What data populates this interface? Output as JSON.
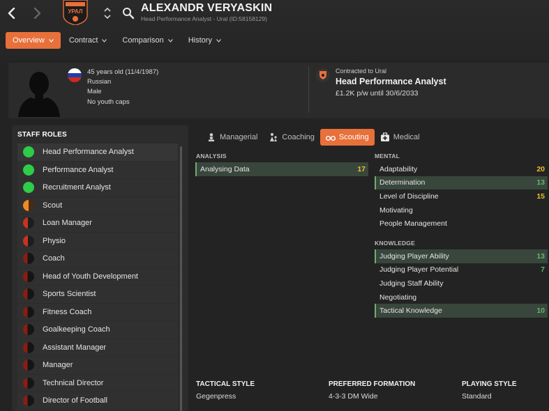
{
  "header": {
    "name": "ALEXANDR VERYASKIN",
    "subtitle": "Head Performance Analyst - Ural (ID:58158129)",
    "club_badge_text": "УРАЛ",
    "tabs": [
      {
        "label": "Overview",
        "active": true
      },
      {
        "label": "Contract",
        "active": false
      },
      {
        "label": "Comparison",
        "active": false
      },
      {
        "label": "History",
        "active": false
      }
    ]
  },
  "profile": {
    "age": "45 years old (11/4/1987)",
    "nationality": "Russian",
    "gender": "Male",
    "youth_caps": "No youth caps",
    "contract_label": "Contracted to Ural",
    "contract_role": "Head Performance Analyst",
    "wage": "£1.2K p/w until 30/6/2033"
  },
  "roles": {
    "title": "STAFF ROLES",
    "items": [
      {
        "label": "Head Performance Analyst",
        "rating": "green",
        "selected": true
      },
      {
        "label": "Performance Analyst",
        "rating": "green"
      },
      {
        "label": "Recruitment Analyst",
        "rating": "green"
      },
      {
        "label": "Scout",
        "rating": "orange"
      },
      {
        "label": "Loan Manager",
        "rating": "red"
      },
      {
        "label": "Physio",
        "rating": "red"
      },
      {
        "label": "Coach",
        "rating": "darkred"
      },
      {
        "label": "Head of Youth Development",
        "rating": "darkred"
      },
      {
        "label": "Sports Scientist",
        "rating": "darkred"
      },
      {
        "label": "Fitness Coach",
        "rating": "darkred"
      },
      {
        "label": "Goalkeeping Coach",
        "rating": "darkred"
      },
      {
        "label": "Assistant Manager",
        "rating": "darkred"
      },
      {
        "label": "Manager",
        "rating": "darkred"
      },
      {
        "label": "Technical Director",
        "rating": "darkred"
      },
      {
        "label": "Director of Football",
        "rating": "darkred"
      }
    ]
  },
  "subtabs": [
    {
      "label": "Managerial",
      "icon": "chess-pawn-icon",
      "active": false
    },
    {
      "label": "Coaching",
      "icon": "coaching-icon",
      "active": false
    },
    {
      "label": "Scouting",
      "icon": "binoculars-icon",
      "active": true
    },
    {
      "label": "Medical",
      "icon": "medical-kit-icon",
      "active": false
    }
  ],
  "analysis": {
    "title": "ANALYSIS",
    "items": [
      {
        "label": "Analysing Data",
        "value": "17",
        "color": "yellow",
        "hl": true
      }
    ]
  },
  "mental": {
    "title": "MENTAL",
    "items": [
      {
        "label": "Adaptability",
        "value": "20",
        "color": "yellow",
        "hl": false
      },
      {
        "label": "Determination",
        "value": "13",
        "color": "green",
        "hl": true
      },
      {
        "label": "Level of Discipline",
        "value": "15",
        "color": "yellow",
        "hl": false
      },
      {
        "label": "Motivating",
        "value": "",
        "color": "",
        "hl": false
      },
      {
        "label": "People Management",
        "value": "",
        "color": "",
        "hl": false
      }
    ]
  },
  "knowledge": {
    "title": "KNOWLEDGE",
    "items": [
      {
        "label": "Judging Player Ability",
        "value": "13",
        "color": "green",
        "hl": true
      },
      {
        "label": "Judging Player Potential",
        "value": "7",
        "color": "green",
        "hl": false
      },
      {
        "label": "Judging Staff Ability",
        "value": "",
        "color": "",
        "hl": false
      },
      {
        "label": "Negotiating",
        "value": "",
        "color": "",
        "hl": false
      },
      {
        "label": "Tactical Knowledge",
        "value": "10",
        "color": "green",
        "hl": true
      }
    ]
  },
  "tactics": {
    "style_label": "TACTICAL STYLE",
    "style_value": "Gegenpress",
    "formation_label": "PREFERRED FORMATION",
    "formation_value": "4-3-3 DM Wide",
    "playing_label": "PLAYING STYLE",
    "playing_value": "Standard"
  },
  "colors": {
    "accent": "#e8703a",
    "green": "#2ecc48",
    "orange": "#f08a24",
    "red": "#c8331f",
    "darkred": "#8a1d14"
  }
}
